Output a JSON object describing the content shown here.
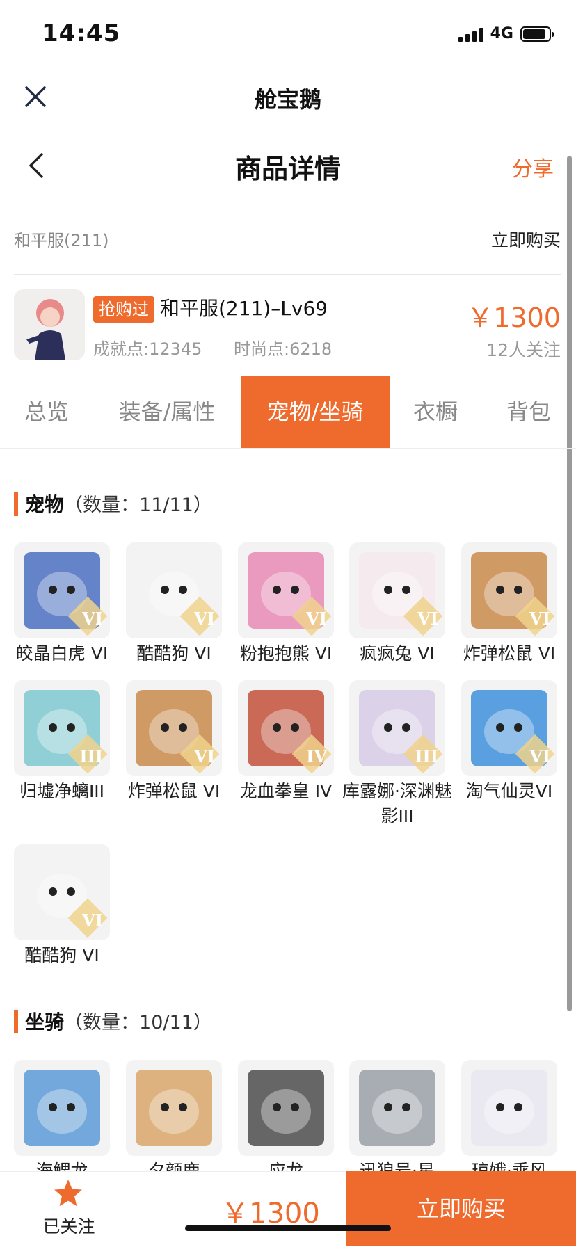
{
  "status": {
    "time": "14:45",
    "network": "4G"
  },
  "app": {
    "title": "舱宝鹅"
  },
  "header": {
    "title": "商品详情",
    "share": "分享"
  },
  "server_row": {
    "server": "和平服(211)",
    "buy_now": "立即购买"
  },
  "product": {
    "badge": "抢购过",
    "name": "和平服(211)–Lv69",
    "achievement": "成就点:12345",
    "fashion": "时尚点:6218",
    "price": "￥1300",
    "followers": "12人关注"
  },
  "tabs": [
    {
      "label": "总览",
      "active": false
    },
    {
      "label": "装备/属性",
      "active": false
    },
    {
      "label": "宠物/坐骑",
      "active": true
    },
    {
      "label": "衣橱",
      "active": false
    },
    {
      "label": "背包",
      "active": false
    }
  ],
  "pets_section": {
    "title": "宠物",
    "count": "（数量：11/11）"
  },
  "pets": [
    {
      "name": "皎晶白虎 VI",
      "rank": "VI",
      "color": "#4a6fbf"
    },
    {
      "name": "酷酷狗 VI",
      "rank": "VI",
      "color": "#f2f2f2"
    },
    {
      "name": "粉抱抱熊 VI",
      "rank": "VI",
      "color": "#e889b5"
    },
    {
      "name": "疯疯兔 VI",
      "rank": "VI",
      "color": "#f5e9ec"
    },
    {
      "name": "炸弹松鼠 VI",
      "rank": "VI",
      "color": "#c98a4b"
    },
    {
      "name": "归墟净螭III",
      "rank": "III",
      "color": "#7fc8d0"
    },
    {
      "name": "炸弹松鼠 VI",
      "rank": "VI",
      "color": "#c98a4b"
    },
    {
      "name": "龙血拳皇 IV",
      "rank": "IV",
      "color": "#c2503a"
    },
    {
      "name": "库露娜·深渊魅影III",
      "rank": "III",
      "color": "#d6cbe6"
    },
    {
      "name": "淘气仙灵VI",
      "rank": "VI",
      "color": "#3e8fdb"
    },
    {
      "name": "酷酷狗 VI",
      "rank": "VI",
      "color": "#f2f2f2"
    }
  ],
  "mounts_section": {
    "title": "坐骑",
    "count": "（数量：10/11）"
  },
  "mounts": [
    {
      "name": "海鳃龙",
      "color": "#5a9ad6"
    },
    {
      "name": "夕颜鹿",
      "color": "#d8a66a"
    },
    {
      "name": "应龙",
      "color": "#4c4c4c"
    },
    {
      "name": "迅狼号·星",
      "color": "#9aa0a8"
    },
    {
      "name": "琼娥·乘风",
      "color": "#e7e6f0"
    }
  ],
  "bottom": {
    "follow_label": "已关注",
    "price": "￥1300",
    "buy_label": "立即购买"
  }
}
